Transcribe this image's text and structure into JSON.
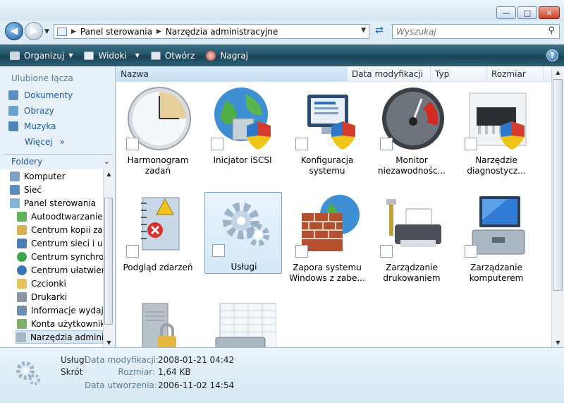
{
  "breadcrumb": [
    "Panel sterowania",
    "Narzędzia administracyjne"
  ],
  "search": {
    "placeholder": "Wyszukaj"
  },
  "toolbar": {
    "organize": "Organizuj",
    "views": "Widoki",
    "open": "Otwórz",
    "burn": "Nagraj"
  },
  "nav": {
    "favorites_header": "Ulubione łącza",
    "favorites": [
      {
        "label": "Dokumenty",
        "icon": "documents-icon"
      },
      {
        "label": "Obrazy",
        "icon": "pictures-icon"
      },
      {
        "label": "Muzyka",
        "icon": "music-icon"
      }
    ],
    "more": "Więcej",
    "folders_header": "Foldery",
    "tree": [
      "Komputer",
      "Sieć",
      "Panel sterowania",
      "Autoodtwarzanie",
      "Centrum kopii zap",
      "Centrum sieci i ud",
      "Centrum synchron",
      "Centrum ułatwień",
      "Czcionki",
      "Drukarki",
      "Informacje wydajn",
      "Konta użytkownikó",
      "Narzędzia adminis"
    ]
  },
  "columns": [
    "Nazwa",
    "Data modyfikacji",
    "Typ",
    "Rozmiar"
  ],
  "items": [
    {
      "l1": "Harmonogram",
      "l2": "zadań",
      "icon": "clock-icon"
    },
    {
      "l1": "Inicjator iSCSI",
      "l2": "",
      "icon": "globe-shield-icon"
    },
    {
      "l1": "Konfiguracja",
      "l2": "systemu",
      "icon": "monitor-shield-icon"
    },
    {
      "l1": "Monitor",
      "l2": "niezawodnośc...",
      "icon": "gauge-icon"
    },
    {
      "l1": "Narzędzie",
      "l2": "diagnostycz...",
      "icon": "memory-chip-icon"
    },
    {
      "l1": "Podgląd zdarzeń",
      "l2": "",
      "icon": "event-log-icon"
    },
    {
      "l1": "Usługi",
      "l2": "",
      "icon": "gears-icon"
    },
    {
      "l1": "Zapora systemu",
      "l2": "Windows z zabe...",
      "icon": "firewall-icon"
    },
    {
      "l1": "Zarządzanie",
      "l2": "drukowaniem",
      "icon": "printer-icon"
    },
    {
      "l1": "Zarządzanie",
      "l2": "komputerem",
      "icon": "computer-toolbox-icon"
    },
    {
      "l1": "",
      "l2": "",
      "icon": "server-lock-icon"
    },
    {
      "l1": "",
      "l2": "",
      "icon": "spreadsheet-toolbox-icon"
    }
  ],
  "details": {
    "name": "Usługi",
    "type": "Skrót",
    "modified_label": "Data modyfikacji:",
    "modified": "2008-01-21 04:42",
    "size_label": "Rozmiar:",
    "size": "1,64 KB",
    "created_label": "Data utworzenia:",
    "created": "2006-11-02 14:54"
  }
}
